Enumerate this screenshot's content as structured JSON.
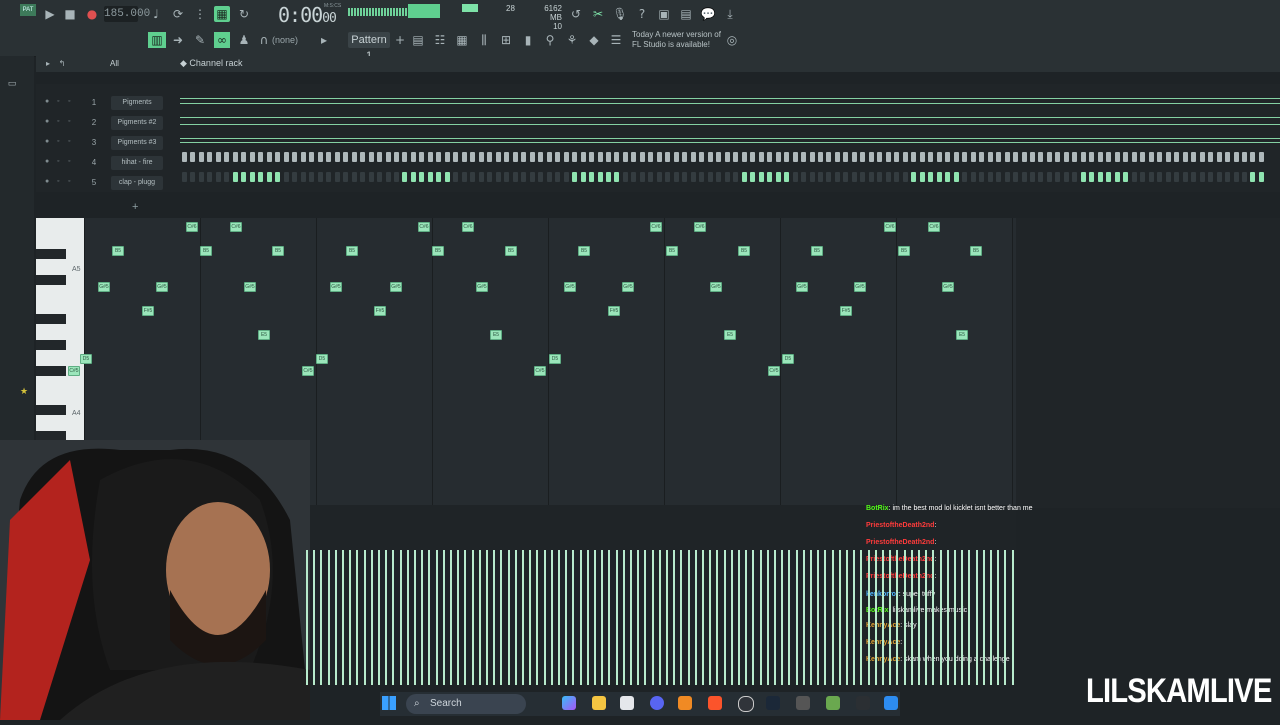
{
  "toolbar": {
    "song_mode": "PAT",
    "tempo": "185.000",
    "timecode": "0:00",
    "timecode_sub": "00",
    "timecode_label": "M:S:CS",
    "cpu": "28",
    "memory": "6162 MB",
    "voices": "10",
    "snap": "(none)",
    "pattern": "Pattern 1",
    "news_line1": "Today  A newer version of",
    "news_line2": "FL Studio is available!"
  },
  "browser": {
    "filter": "All"
  },
  "channel_rack": {
    "title": "Channel rack",
    "channels": [
      {
        "num": "1",
        "name": "Pigments"
      },
      {
        "num": "2",
        "name": "Pigments #2"
      },
      {
        "num": "3",
        "name": "Pigments #3"
      },
      {
        "num": "4",
        "name": "hihat - fire"
      },
      {
        "num": "5",
        "name": "clap - plugg"
      }
    ]
  },
  "piano_roll": {
    "key_labels": [
      "A5",
      "A4"
    ],
    "notes": [
      {
        "label": "C#6"
      },
      {
        "label": "C#6"
      },
      {
        "label": "B5"
      },
      {
        "label": "B5"
      },
      {
        "label": "B5"
      },
      {
        "label": "G#5"
      },
      {
        "label": "F#5"
      },
      {
        "label": "E5"
      },
      {
        "label": "D5"
      },
      {
        "label": "C#5"
      }
    ]
  },
  "chat": [
    {
      "user": "BotRix",
      "message": ": im the best mod lol kicklet isnt better than me",
      "user_color": "#53fc18"
    },
    {
      "user": "PriestoftheDeath2nd",
      "message": ":",
      "user_color": "#ff3b3b"
    },
    {
      "user": "PriestoftheDeath2nd",
      "message": ":",
      "user_color": "#ff3b3b"
    },
    {
      "user": "PriestoftheDeath2nd",
      "message": ":",
      "user_color": "#ff3b3b"
    },
    {
      "user": "PriestoftheDeath2nd",
      "message": ":",
      "user_color": "#ff3b3b"
    },
    {
      "user": "kenkorror",
      "message": ": super tuffy",
      "user_color": "#4db6ff"
    },
    {
      "user": "BotRix",
      "message": ": lilskamlive makes music",
      "user_color": "#53fc18"
    },
    {
      "user": "KennyAce",
      "message": ": slay",
      "user_color": "#e0a030"
    },
    {
      "user": "KennyAce",
      "message": ":",
      "user_color": "#e0a030"
    },
    {
      "user": "KennyAce",
      "message": ": skam when you doing a challenge",
      "user_color": "#e0a030"
    }
  ],
  "taskbar": {
    "search_placeholder": "Search"
  },
  "watermark": "LILSKAMLIVE",
  "colors": {
    "accent": "#8fe4b0",
    "background": "#1e2326"
  }
}
